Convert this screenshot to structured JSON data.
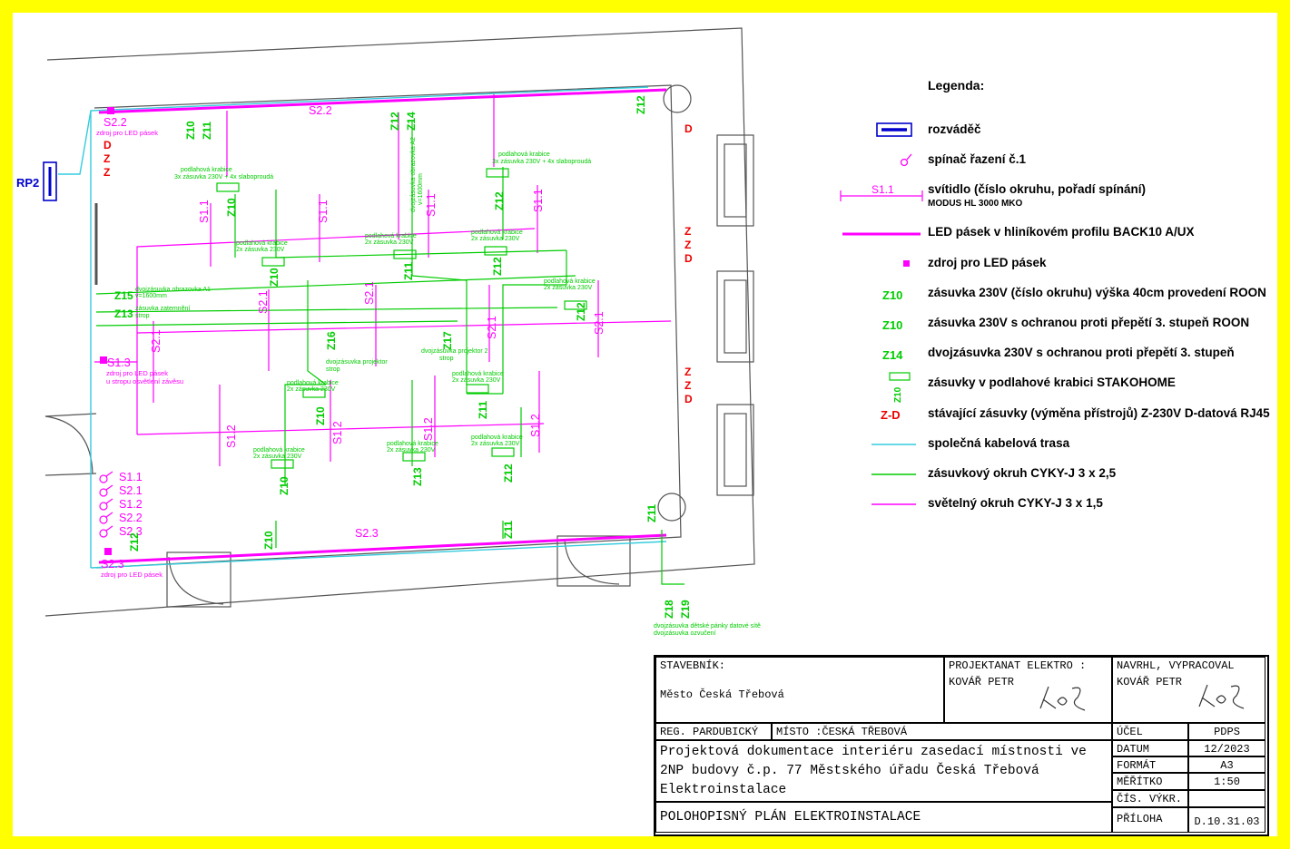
{
  "plan": {
    "panel_label": "RP2",
    "circuit_labels": {
      "s22_top": "S2.2",
      "s22_left": "S2.2",
      "s23_bottom": "S2.3",
      "s23_left": "S2.3",
      "s13": "S1.3",
      "s11_a": "S1.1",
      "s11_b": "S1.1",
      "s11_c": "S1.1",
      "s11_d": "S1.1",
      "s21_a": "S2.1",
      "s21_b": "S2.1",
      "s21_c": "S2.1",
      "s21_d": "S2.1",
      "s21_e": "S2.1",
      "s12_a": "S1.2",
      "s12_b": "S1.2",
      "s12_c": "S1.2",
      "s12_d": "S1.2"
    },
    "switch_labels": [
      "S1.1",
      "S2.1",
      "S1.2",
      "S2.2",
      "S2.3"
    ],
    "notes": {
      "led_src_top": "zdroj pro LED pásek",
      "led_src_bottom": "zdroj pro LED pásek",
      "led_src_mid": "zdroj pro LED pásek",
      "led_src_mid2": "u stropu osvětlení závěsu"
    },
    "socket_labels": {
      "z10_a": "Z10",
      "z11_a": "Z11",
      "z12_a": "Z12",
      "z14_a": "Z14",
      "z12_b": "Z12",
      "z10_b": "Z10",
      "z12_c": "Z12",
      "z11_b": "Z11",
      "z12_d": "Z12",
      "z10_c": "Z10",
      "z12_e": "Z12",
      "z15": "Z15",
      "z13": "Z13",
      "z16": "Z16",
      "z17": "Z17",
      "z10_d": "Z10",
      "z11_c": "Z11",
      "z10_e": "Z10",
      "z13_b": "Z13",
      "z12_f": "Z12",
      "z10_f": "Z10",
      "z12_g": "Z12",
      "z18": "Z18",
      "z19": "Z19",
      "z11_d": "Z11",
      "z11_e": "Z11",
      "z1z": "Z10"
    },
    "floorbox_notes": {
      "fb1": "podlahová krabice",
      "fb1b": "3x zásuvka 230V + 4x slaboproudá",
      "fb2": "podlahová krabice",
      "fb2b": "3x zásuvka 230V + 4x slaboproudá",
      "small": "podlahová krabice",
      "smallb": "2x zásuvka 230V",
      "proj1": "dvojzásuvka projektor",
      "proj1b": "strop",
      "proj2": "dvojzásuvka projektor 2",
      "proj2b": "strop",
      "cabinet": "dvojzásuvka obrazovka A1",
      "cabinet_b": "v=1600mm",
      "cabinet2": "zásuvka zatemnění",
      "cabinet2b": "strop",
      "window": "dvojzásuvka obrazovka A2",
      "windowb": "v=1600mm",
      "bottom": "dvojzásuvka dětské pánky datové sítě",
      "bottomb": "dvojzásuvka ozvučení"
    }
  },
  "legend": {
    "title": "Legenda:",
    "items": [
      {
        "text": "rozváděč"
      },
      {
        "text": "spínač řazení č.1"
      },
      {
        "text": "svítidlo (číslo okruhu, pořadí spínání)",
        "sub": "MODUS HL 3000 MKO",
        "symbol_label": "S1.1"
      },
      {
        "text": "LED pásek v hliníkovém profilu BACK10 A/UX"
      },
      {
        "text": "zdroj pro LED pásek"
      },
      {
        "text": "zásuvka 230V (číslo okruhu) výška 40cm provedení ROON",
        "symbol_label": "Z10"
      },
      {
        "text": "zásuvka 230V s ochranou proti přepětí 3. stupeň  ROON",
        "symbol_label": "Z10"
      },
      {
        "text": "dvojzásuvka 230V s ochranou proti přepětí 3. stupeň",
        "symbol_label": "Z14"
      },
      {
        "text": "zásuvky v podlahové krabici STAKOHOME",
        "symbol_label": "Z10"
      },
      {
        "text": "stávající zásuvky (výměna přístrojů) Z-230V D-datová RJ45",
        "symbol_label": "Z-D"
      },
      {
        "text": "společná kabelová trasa"
      },
      {
        "text": "zásuvkový okruh CYKY-J 3 x 2,5"
      },
      {
        "text": "světelný okruh CYKY-J 3 x 1,5"
      }
    ],
    "colors": {
      "magenta": "#ff00ff",
      "green": "#00cc00",
      "cyan": "#33ccdd",
      "blue": "#0000cc",
      "red": "#ee0000"
    }
  },
  "title_block": {
    "investor_label": "STAVEBNÍK:",
    "investor_value": "Město Česká Třebová",
    "designer_label": "PROJEKTANAT ELEKTRO :",
    "designer_value": "KOVÁŘ PETR",
    "drawn_label": "NAVRHL, VYPRACOVAL",
    "drawn_value": "KOVÁŘ PETR",
    "region": "REG. PARDUBICKÝ",
    "place": "MÍSTO :ČESKÁ TŘEBOVÁ",
    "description": "Projektová dokumentace interiéru zasedací místnosti ve 2NP budovy č.p. 77 Městského úřadu Česká Třebová Elektroinstalace",
    "drawing_title": "POLOHOPISNÝ PLÁN ELEKTROINSTALACE",
    "fields": [
      {
        "label": "ÚČEL",
        "value": "PDPS"
      },
      {
        "label": "DATUM",
        "value": "12/2023"
      },
      {
        "label": "FORMÁT",
        "value": "A3"
      },
      {
        "label": "MĚŘÍTKO",
        "value": "1:50"
      },
      {
        "label": "ČÍS. VÝKR.",
        "value": ""
      },
      {
        "label": "PŘÍLOHA",
        "value": "D.10.31.03"
      }
    ]
  }
}
